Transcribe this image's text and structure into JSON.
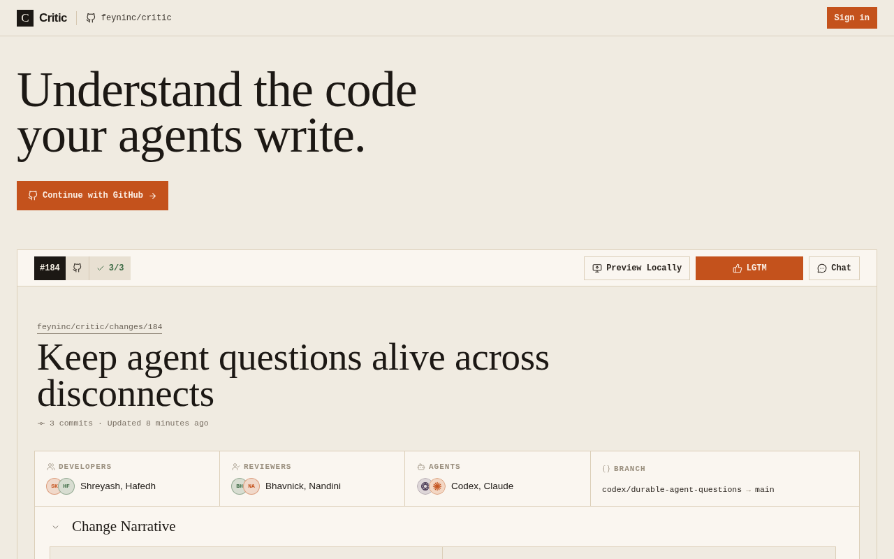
{
  "header": {
    "logo_letter": "C",
    "brand": "Critic",
    "repo": "feyninc/critic",
    "sign_in": "Sign in"
  },
  "hero": {
    "title_lines": [
      "Understand the code",
      "your agents write."
    ],
    "cta": "Continue with GitHub"
  },
  "toolbar": {
    "pr_number": "#184",
    "checks": "3/3",
    "actions": [
      {
        "label": "Preview Locally",
        "kind": "outline"
      },
      {
        "label": "LGTM",
        "kind": "primary"
      },
      {
        "label": "Chat",
        "kind": "outline"
      }
    ]
  },
  "change": {
    "breadcrumb": "feyninc/critic/changes/184",
    "title": "Keep agent questions alive across disconnects",
    "meta": "3 commits · Updated 8 minutes ago"
  },
  "details": [
    {
      "kind": "people",
      "label": "DEVELOPERS",
      "avatars": [
        {
          "initials": "SK",
          "color": "#c4521c"
        },
        {
          "initials": "HF",
          "color": "#3d6b45"
        }
      ],
      "names": "Shreyash, Hafedh"
    },
    {
      "kind": "people",
      "label": "REVIEWERS",
      "avatars": [
        {
          "initials": "BH",
          "color": "#3d6b45"
        },
        {
          "initials": "NA",
          "color": "#c4521c"
        }
      ],
      "names": "Bhavnick, Nandini"
    },
    {
      "kind": "agents",
      "label": "AGENTS",
      "agents": [
        {
          "kind": "knot"
        },
        {
          "kind": "sunburst"
        }
      ],
      "names": "Codex, Claude"
    },
    {
      "kind": "branch",
      "label": "BRANCH",
      "source": "codex/durable-agent-questions",
      "arrow": "→",
      "target": "main"
    }
  ],
  "narrative": {
    "title": "Change Narrative",
    "expanded": true
  }
}
